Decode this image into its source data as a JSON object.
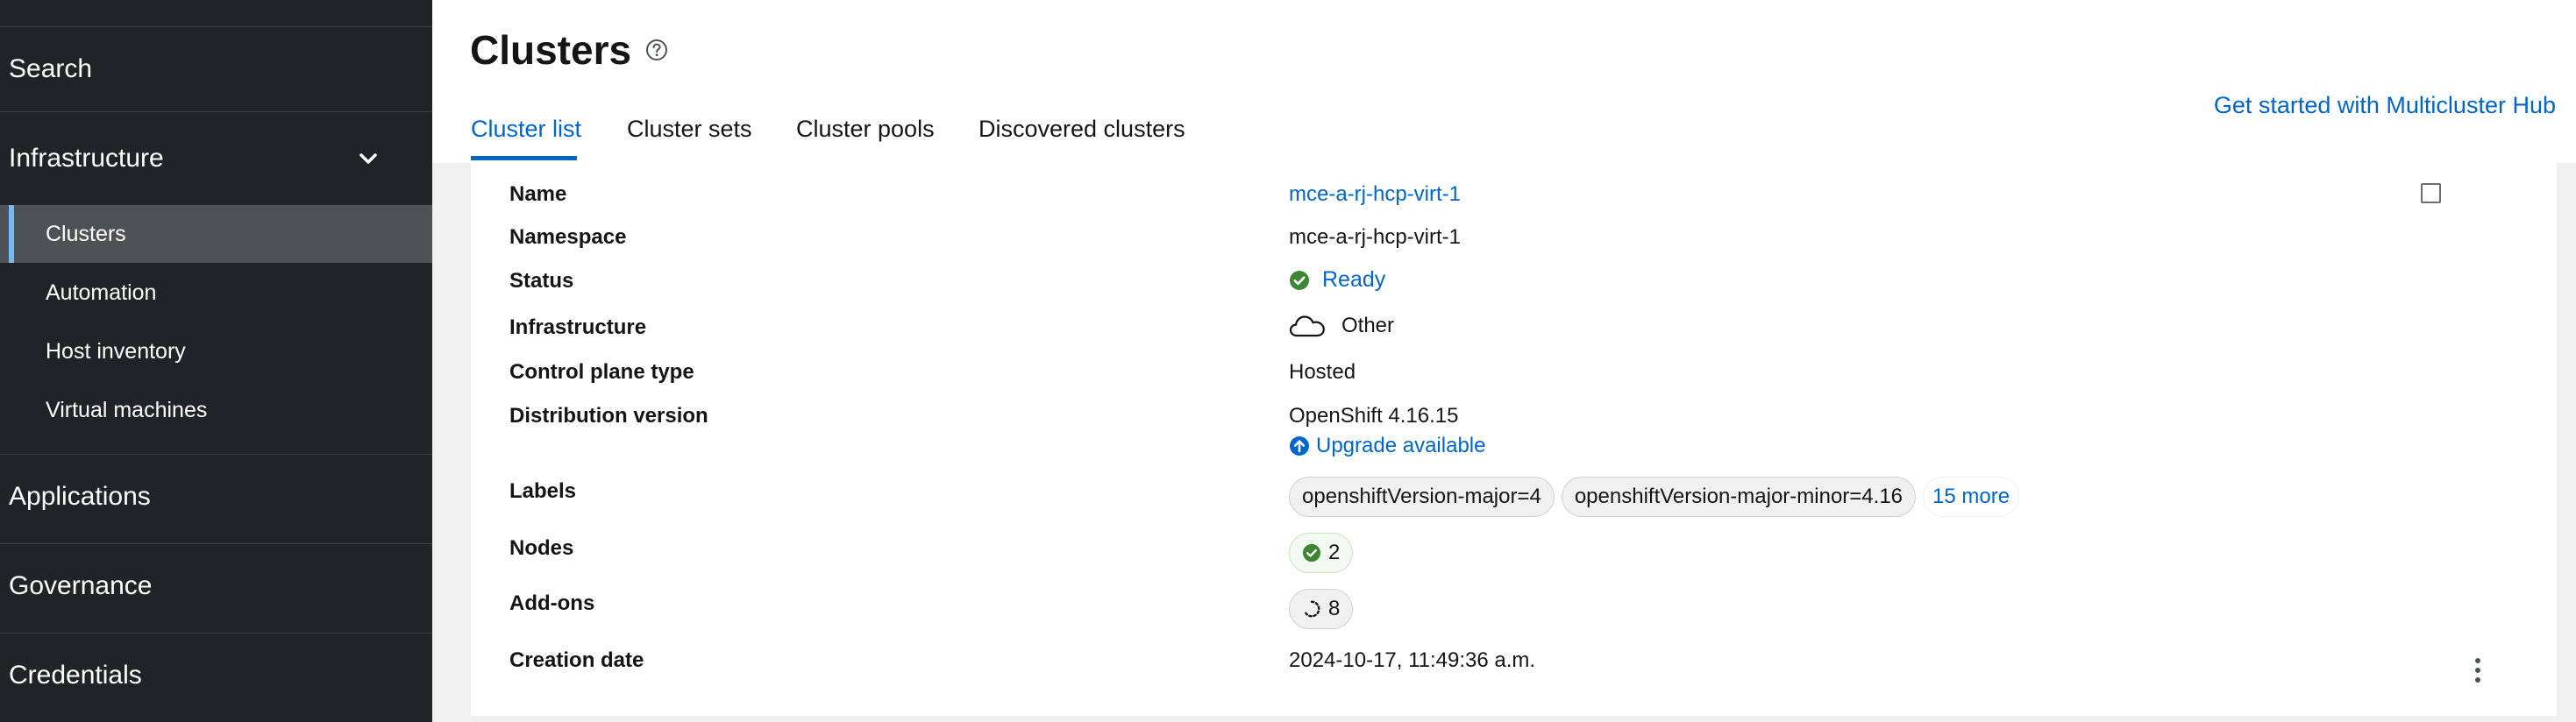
{
  "sidebar": {
    "search_label": "Search",
    "infrastructure_label": "Infrastructure",
    "items": [
      {
        "label": "Clusters"
      },
      {
        "label": "Automation"
      },
      {
        "label": "Host inventory"
      },
      {
        "label": "Virtual machines"
      }
    ],
    "sections": [
      {
        "label": "Applications"
      },
      {
        "label": "Governance"
      },
      {
        "label": "Credentials"
      }
    ]
  },
  "header": {
    "title": "Clusters",
    "tabs": [
      {
        "label": "Cluster list"
      },
      {
        "label": "Cluster sets"
      },
      {
        "label": "Cluster pools"
      },
      {
        "label": "Discovered clusters"
      }
    ],
    "get_started_link": "Get started with Multicluster Hub"
  },
  "details": {
    "name_label": "Name",
    "name_value": "mce-a-rj-hcp-virt-1",
    "namespace_label": "Namespace",
    "namespace_value": "mce-a-rj-hcp-virt-1",
    "status_label": "Status",
    "status_value": "Ready",
    "infrastructure_label": "Infrastructure",
    "infrastructure_value": "Other",
    "control_plane_label": "Control plane type",
    "control_plane_value": "Hosted",
    "distribution_label": "Distribution version",
    "distribution_value": "OpenShift 4.16.15",
    "upgrade_link": "Upgrade available",
    "labels_label": "Labels",
    "labels": [
      "openshiftVersion-major=4",
      "openshiftVersion-major-minor=4.16"
    ],
    "labels_more": "15 more",
    "nodes_label": "Nodes",
    "nodes_count": "2",
    "addons_label": "Add-ons",
    "addons_count": "8",
    "creation_label": "Creation date",
    "creation_value": "2024-10-17, 11:49:36 a.m."
  },
  "colors": {
    "sidebar_bg": "#212427",
    "active_item_bg": "#4f5255",
    "active_accent": "#73bcf7",
    "link": "#0066cc",
    "success": "#3e8635"
  },
  "icons": [
    "help-icon",
    "chevron-down-icon",
    "check-circle-icon",
    "cloud-icon",
    "arrow-circle-up-icon",
    "spinner-icon",
    "kebab-icon"
  ]
}
